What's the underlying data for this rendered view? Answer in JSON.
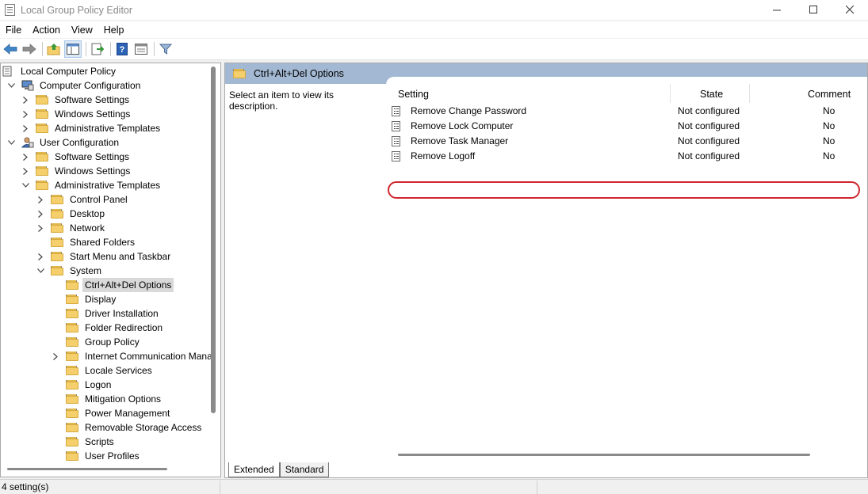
{
  "window": {
    "title": "Local Group Policy Editor"
  },
  "menu": [
    "File",
    "Action",
    "View",
    "Help"
  ],
  "toolbar": {
    "buttons": [
      "back-icon",
      "forward-icon",
      "up-folder-icon",
      "show-hide-tree-icon",
      "export-list-icon",
      "help-icon",
      "properties-icon",
      "filter-icon"
    ]
  },
  "tree": {
    "items": [
      {
        "label": "Local Computer Policy",
        "level": 0,
        "expander": "none",
        "icon": "policy-icon"
      },
      {
        "label": "Computer Configuration",
        "level": 1,
        "expander": "expanded",
        "icon": "computer-icon"
      },
      {
        "label": "Software Settings",
        "level": 2,
        "expander": "collapsed",
        "icon": "folder-icon"
      },
      {
        "label": "Windows Settings",
        "level": 2,
        "expander": "collapsed",
        "icon": "folder-icon"
      },
      {
        "label": "Administrative Templates",
        "level": 2,
        "expander": "collapsed",
        "icon": "folder-icon"
      },
      {
        "label": "User Configuration",
        "level": 1,
        "expander": "expanded",
        "icon": "user-icon"
      },
      {
        "label": "Software Settings",
        "level": 2,
        "expander": "collapsed",
        "icon": "folder-icon"
      },
      {
        "label": "Windows Settings",
        "level": 2,
        "expander": "collapsed",
        "icon": "folder-icon"
      },
      {
        "label": "Administrative Templates",
        "level": 2,
        "expander": "expanded",
        "icon": "folder-icon"
      },
      {
        "label": "Control Panel",
        "level": 3,
        "expander": "collapsed",
        "icon": "folder-icon"
      },
      {
        "label": "Desktop",
        "level": 3,
        "expander": "collapsed",
        "icon": "folder-icon"
      },
      {
        "label": "Network",
        "level": 3,
        "expander": "collapsed",
        "icon": "folder-icon"
      },
      {
        "label": "Shared Folders",
        "level": 3,
        "expander": "none",
        "icon": "folder-icon"
      },
      {
        "label": "Start Menu and Taskbar",
        "level": 3,
        "expander": "collapsed",
        "icon": "folder-icon"
      },
      {
        "label": "System",
        "level": 3,
        "expander": "expanded",
        "icon": "folder-icon"
      },
      {
        "label": "Ctrl+Alt+Del Options",
        "level": 4,
        "expander": "none",
        "icon": "folder-icon",
        "selected": true
      },
      {
        "label": "Display",
        "level": 4,
        "expander": "none",
        "icon": "folder-icon"
      },
      {
        "label": "Driver Installation",
        "level": 4,
        "expander": "none",
        "icon": "folder-icon"
      },
      {
        "label": "Folder Redirection",
        "level": 4,
        "expander": "none",
        "icon": "folder-icon"
      },
      {
        "label": "Group Policy",
        "level": 4,
        "expander": "none",
        "icon": "folder-icon"
      },
      {
        "label": "Internet Communication Mana",
        "level": 4,
        "expander": "collapsed",
        "icon": "folder-icon"
      },
      {
        "label": "Locale Services",
        "level": 4,
        "expander": "none",
        "icon": "folder-icon"
      },
      {
        "label": "Logon",
        "level": 4,
        "expander": "none",
        "icon": "folder-icon"
      },
      {
        "label": "Mitigation Options",
        "level": 4,
        "expander": "none",
        "icon": "folder-icon"
      },
      {
        "label": "Power Management",
        "level": 4,
        "expander": "none",
        "icon": "folder-icon"
      },
      {
        "label": "Removable Storage Access",
        "level": 4,
        "expander": "none",
        "icon": "folder-icon"
      },
      {
        "label": "Scripts",
        "level": 4,
        "expander": "none",
        "icon": "folder-icon"
      },
      {
        "label": "User Profiles",
        "level": 4,
        "expander": "none",
        "icon": "folder-icon"
      }
    ]
  },
  "details": {
    "header_title": "Ctrl+Alt+Del Options",
    "description": "Select an item to view its description.",
    "columns": [
      "Setting",
      "State",
      "Comment"
    ],
    "rows": [
      {
        "setting": "Remove Change Password",
        "state": "Not configured",
        "comment": "No"
      },
      {
        "setting": "Remove Lock Computer",
        "state": "Not configured",
        "comment": "No",
        "highlighted": true
      },
      {
        "setting": "Remove Task Manager",
        "state": "Not configured",
        "comment": "No"
      },
      {
        "setting": "Remove Logoff",
        "state": "Not configured",
        "comment": "No"
      }
    ]
  },
  "tabs": [
    "Extended",
    "Standard"
  ],
  "status": {
    "text": "4 setting(s)"
  },
  "colors": {
    "header_band": "#a3b9d3",
    "highlight_ring": "#d0262d",
    "folder": "#f4cf6b"
  }
}
